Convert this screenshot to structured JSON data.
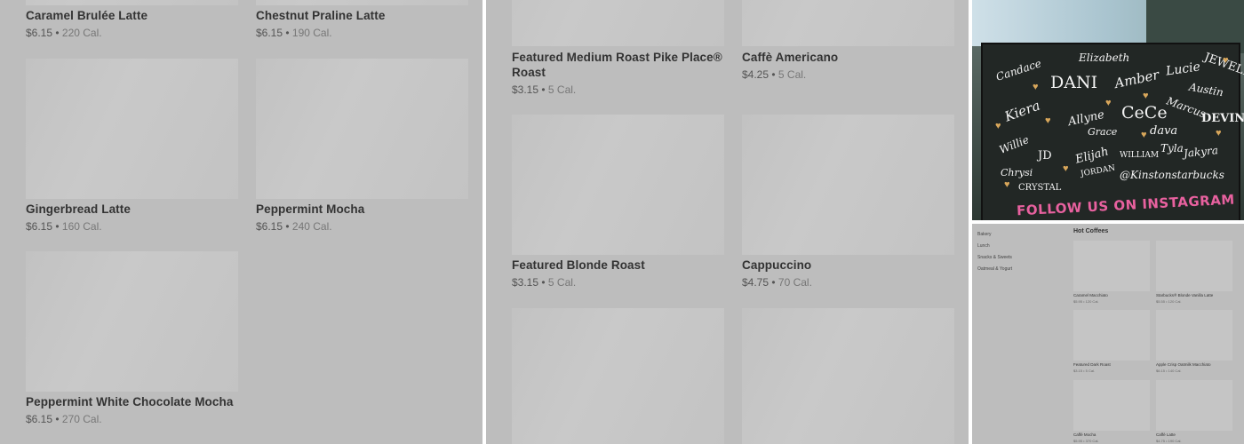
{
  "panel1": {
    "items": [
      {
        "name": "Caramel Brulée Latte",
        "price": "$6.15",
        "cal": "220 Cal."
      },
      {
        "name": "Chestnut Praline Latte",
        "price": "$6.15",
        "cal": "190 Cal."
      },
      {
        "name": "Gingerbread Latte",
        "price": "$6.15",
        "cal": "160 Cal."
      },
      {
        "name": "Peppermint Mocha",
        "price": "$6.15",
        "cal": "240 Cal."
      },
      {
        "name": "Peppermint White Chocolate Mocha",
        "price": "$6.15",
        "cal": "270 Cal."
      }
    ]
  },
  "panel2": {
    "items": [
      {
        "name": "Featured Medium Roast Pike Place® Roast",
        "price": "$3.15",
        "cal": "5 Cal."
      },
      {
        "name": "Caffè Americano",
        "price": "$4.25",
        "cal": "5 Cal."
      },
      {
        "name": "Featured Blonde Roast",
        "price": "$3.15",
        "cal": "5 Cal."
      },
      {
        "name": "Cappuccino",
        "price": "$4.75",
        "cal": "70 Cal."
      }
    ]
  },
  "photo": {
    "names": [
      "Candace",
      "Elizabeth",
      "DANI",
      "Amber",
      "Lucie",
      "JEWELL",
      "Kiera",
      "Allyne",
      "CeCe",
      "Marcus",
      "Austin",
      "DEVIN",
      "Willie",
      "Grace",
      "dava",
      "JD",
      "Elijah",
      "WILLIAM",
      "Tyla",
      "Jakyra",
      "Chrysi",
      "JORDAN",
      "CRYSTAL",
      "@Kinstonstarbucks"
    ],
    "banner": "FOLLOW US ON INSTAGRAM"
  },
  "panel4": {
    "sidebar": [
      "Bakery",
      "Lunch",
      "Snacks & Sweets",
      "Oatmeal & Yogurt"
    ],
    "section_title": "Hot Coffees",
    "items": [
      {
        "name": "Caramel Macchiato",
        "price": "$5.95",
        "cal": "120 Cal."
      },
      {
        "name": "Starbucks® Blonde Vanilla Latte",
        "price": "$5.55",
        "cal": "120 Cal."
      },
      {
        "name": "Featured Dark Roast",
        "price": "$3.15",
        "cal": "5 Cal."
      },
      {
        "name": "Apple Crisp Oatmilk Macchiato",
        "price": "$6.15",
        "cal": "140 Cal."
      },
      {
        "name": "Caffè Mocha",
        "price": "$5.95",
        "cal": "370 Cal."
      },
      {
        "name": "Caffè Latte",
        "price": "$4.75",
        "cal": "190 Cal."
      }
    ]
  }
}
